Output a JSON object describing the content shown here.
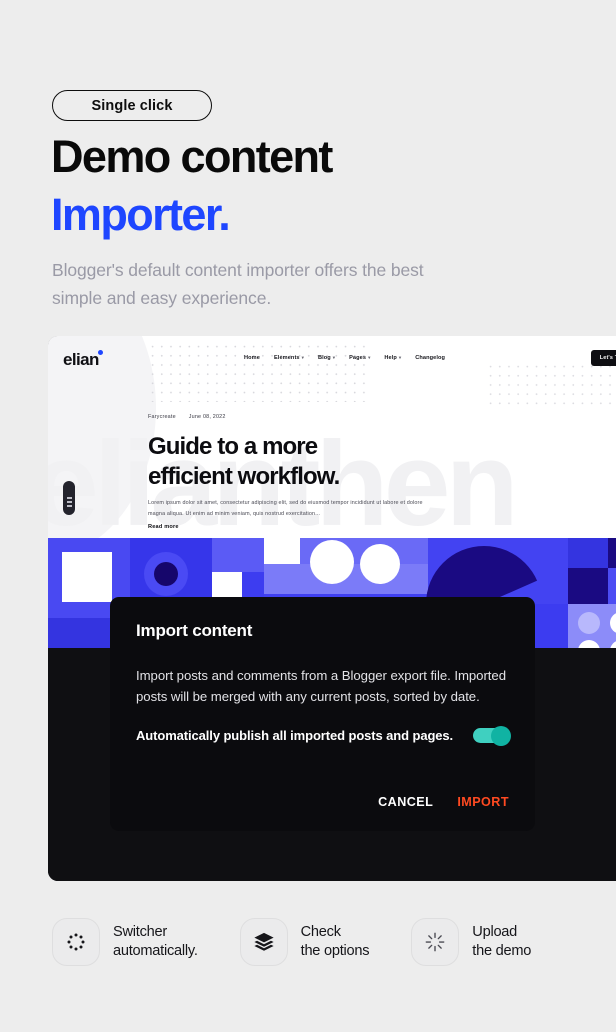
{
  "hero": {
    "badge": "Single click",
    "title_line1": "Demo content",
    "title_line2": "Importer.",
    "subtitle": "Blogger's default content importer offers the best simple and easy experience.",
    "accent_color": "#1e46ff",
    "title_color": "#0a0a0a",
    "subtitle_color": "#9a9aa6",
    "background_color": "#ededed"
  },
  "preview": {
    "logo": "elian",
    "nav": [
      {
        "label": "Home",
        "has_caret": false
      },
      {
        "label": "Elements",
        "has_caret": true
      },
      {
        "label": "Blog",
        "has_caret": true
      },
      {
        "label": "Pages",
        "has_caret": true
      },
      {
        "label": "Help",
        "has_caret": true
      },
      {
        "label": "Changelog",
        "has_caret": false
      }
    ],
    "cta_button": "Let's Talk",
    "watermark": "elianthen",
    "article": {
      "author": "Farycreate",
      "date": "June 08, 2022",
      "heading_line1": "Guide to a more",
      "heading_line2": "efficient workflow.",
      "excerpt": "Lorem ipsum dolor sit amet, consectetur adipiscing elit, sed do eiusmod tempor incididunt ut labore et dolore magna aliqua. Ut enim ad minim veniam, quis nostrud exercitation...",
      "read_more": "Read more"
    },
    "band_colors": {
      "base": "#3d3df0",
      "light": "#5b5bf5",
      "lighter": "#7b7bf8",
      "pale": "#9b9bfb",
      "mid": "#3434e0",
      "deep": "#2020c8",
      "navy": "#16066b",
      "dark_navy": "#1a0a82",
      "white": "#ffffff"
    }
  },
  "modal": {
    "title": "Import content",
    "body": "Import posts and comments from a Blogger export file. Imported posts will be merged with any current posts, sorted by date.",
    "toggle_label": "Automatically publish all imported posts and pages.",
    "toggle_on": true,
    "toggle_color": "#10b3a3",
    "cancel_label": "CANCEL",
    "import_label": "IMPORT",
    "import_color": "#ff4a21",
    "background_color": "#0b0b0e"
  },
  "features": [
    {
      "icon": "dotted-spinner-icon",
      "line1": "Switcher",
      "line2": "automatically."
    },
    {
      "icon": "layers-icon",
      "line1": "Check",
      "line2": "the options"
    },
    {
      "icon": "burst-loading-icon",
      "line1": "Upload",
      "line2": "the demo"
    }
  ]
}
